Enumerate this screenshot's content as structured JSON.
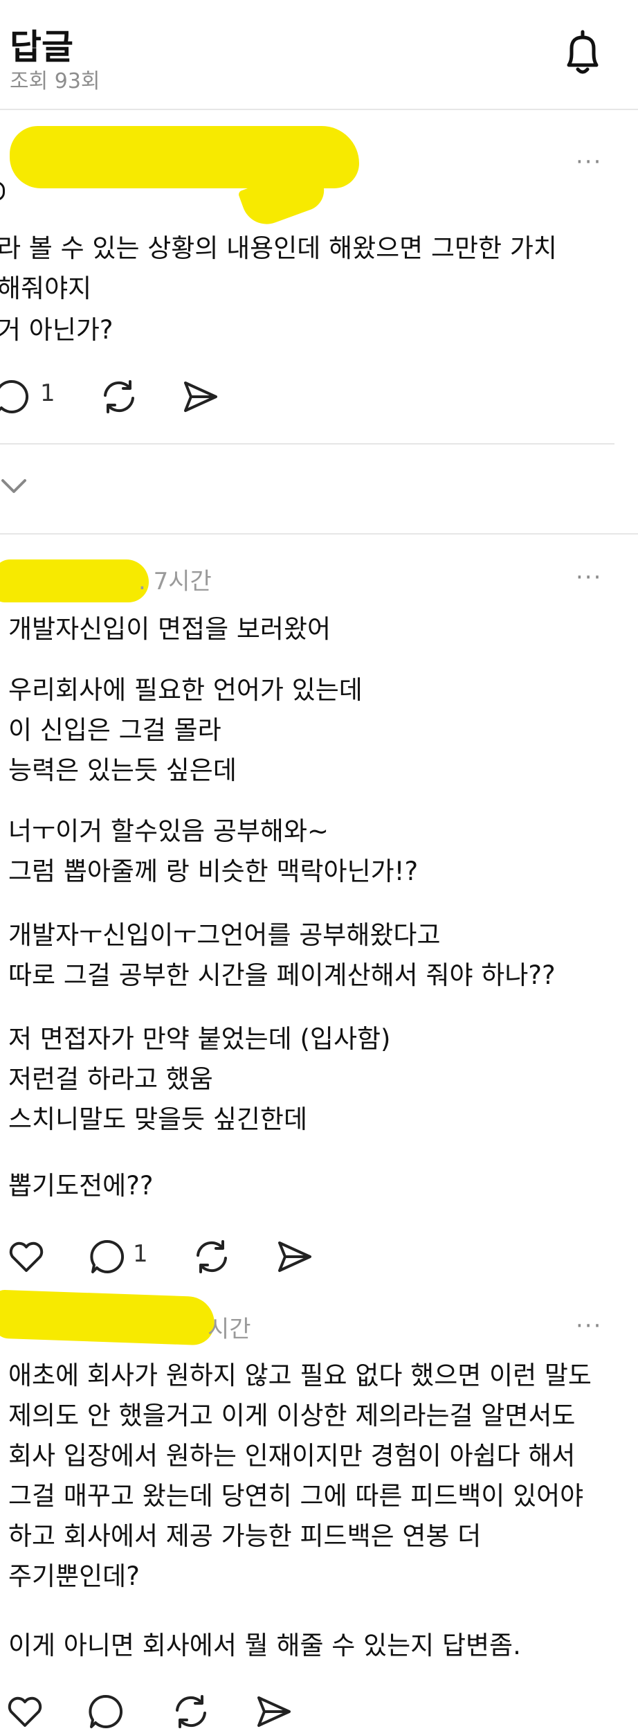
{
  "header": {
    "title": "답글",
    "views": "조회 93회"
  },
  "post": {
    "lines": [
      "라 볼 수 있는 상황의 내용인데 해왔으면 그만한 가치",
      "해줘야지",
      "거 아닌가?"
    ],
    "reply_count": "1",
    "more": "···"
  },
  "replies": [
    {
      "time": ". 7시간",
      "paragraphs": [
        "개발자신입이 면접을 보러왔어",
        "우리회사에 필요한 언어가 있는데\n이 신입은 그걸 몰라\n능력은 있는듯 싶은데",
        "너ㅜ이거 할수있음 공부해와~\n그럼 뽑아줄께 랑 비슷한 맥락아닌가!?",
        "개발자ㅜ신입이ㅜ그언어를 공부해왔다고\n따로 그걸 공부한 시간을 페이계산해서 줘야 하나??",
        "저 면접자가 만약 붙었는데 (입사함)\n저런걸 하라고 했움\n스치니말도 맞을듯 싶긴한데",
        "뽑기도전에??"
      ],
      "reply_count": "1",
      "more": "···"
    },
    {
      "time": "시간",
      "paragraphs": [
        "애초에 회사가 원하지 않고 필요 없다 했으면 이런 말도\n제의도 안 했을거고 이게 이상한 제의라는걸 알면서도\n회사 입장에서 원하는 인재이지만 경험이 아쉽다 해서\n그걸 매꾸고 왔는데 당연히 그에 따른 피드백이 있어야\n하고 회사에서 제공 가능한 피드백은 연봉 더\n주기뿐인데?",
        "이게 아니면 회사에서 뭘 해줄 수 있는지 답변좀."
      ],
      "more": "···"
    }
  ]
}
